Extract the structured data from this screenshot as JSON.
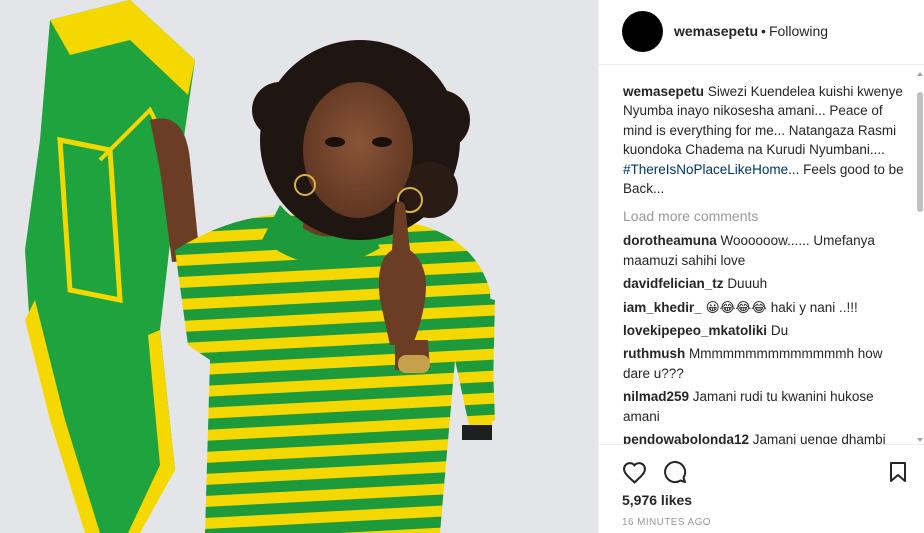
{
  "post": {
    "username": "wemasepetu",
    "separator": "•",
    "follow_status": "Following"
  },
  "caption": {
    "author": "wemasepetu",
    "text": "Siwezi Kuendelea kuishi kwenye Nyumba inayo nikosesha amani... Peace of mind is everything for me... Natangaza Rasmi kuondoka Chadema na Kurudi Nyumbani....",
    "hashtag": "#ThereIsNoPlaceLikeHome",
    "text_after": "... Feels good to be Back..."
  },
  "load_more": "Load more comments",
  "comments": [
    {
      "author": "dorotheamuna",
      "text": "Woooooow...... Umefanya maamuzi sahihi love"
    },
    {
      "author": "davidfelician_tz",
      "text": "Duuuh"
    },
    {
      "author": "iam_khedir_",
      "text": "😀😂😂😂 haki y nani ..!!!"
    },
    {
      "author": "lovekipepeo_mkatoliki",
      "text": "Du"
    },
    {
      "author": "ruthmush",
      "text": "Mmmmmmmmmmmmmmh how dare u???"
    },
    {
      "author": "nilmad259",
      "text": "Jamani rudi tu kwanini hukose amani"
    },
    {
      "author": "pendowabolonda12",
      "text": "Jamani uenge dhambi"
    }
  ],
  "likes": "5,976 likes",
  "timestamp": "16 MINUTES AGO",
  "icons": {
    "like": "heart-outline-icon",
    "comment": "speech-bubble-icon",
    "save": "bookmark-icon"
  }
}
